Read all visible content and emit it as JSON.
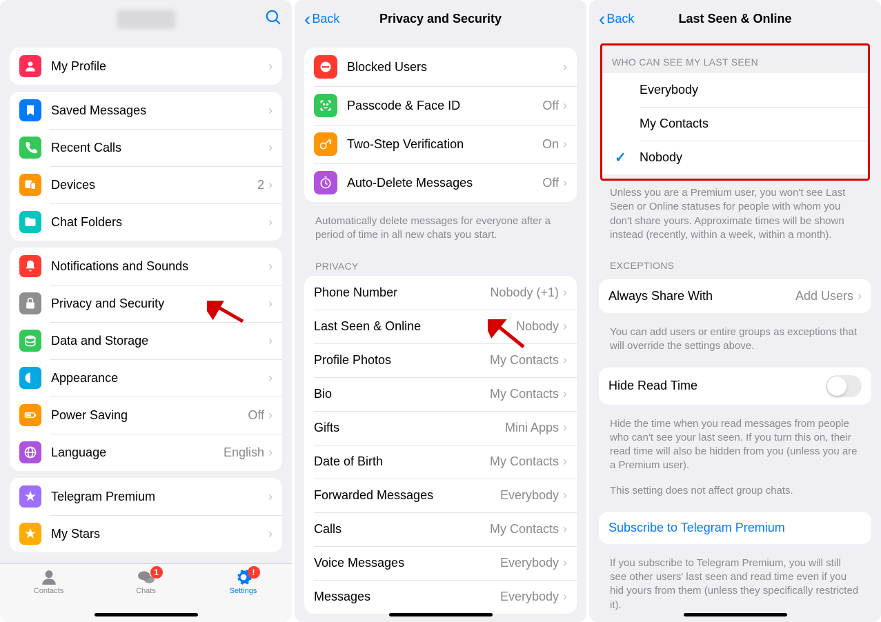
{
  "p1": {
    "groups": [
      [
        {
          "label": "My Profile",
          "ic": "profile",
          "bg": "#ff2d55"
        }
      ],
      [
        {
          "label": "Saved Messages",
          "ic": "bookmark",
          "bg": "#007aff"
        },
        {
          "label": "Recent Calls",
          "ic": "phone",
          "bg": "#34c759"
        },
        {
          "label": "Devices",
          "ic": "devices",
          "bg": "#ff9500",
          "val": "2"
        },
        {
          "label": "Chat Folders",
          "ic": "folder",
          "bg": "#00c7be"
        }
      ],
      [
        {
          "label": "Notifications and Sounds",
          "ic": "bell",
          "bg": "#ff3b30"
        },
        {
          "label": "Privacy and Security",
          "ic": "lock",
          "bg": "#8e8e93"
        },
        {
          "label": "Data and Storage",
          "ic": "storage",
          "bg": "#34c759"
        },
        {
          "label": "Appearance",
          "ic": "appearance",
          "bg": "#06a7e2"
        },
        {
          "label": "Power Saving",
          "ic": "battery",
          "bg": "#ff9500",
          "val": "Off"
        },
        {
          "label": "Language",
          "ic": "globe",
          "bg": "#af52de",
          "val": "English"
        }
      ],
      [
        {
          "label": "Telegram Premium",
          "ic": "star",
          "bg": "#9d6fff"
        },
        {
          "label": "My Stars",
          "ic": "star",
          "bg": "#ffab00"
        }
      ]
    ],
    "tabs": [
      {
        "l": "Contacts",
        "ic": "contact"
      },
      {
        "l": "Chats",
        "ic": "chats",
        "b": "1"
      },
      {
        "l": "Settings",
        "ic": "gear",
        "b": "!",
        "active": true
      }
    ]
  },
  "p2": {
    "back": "Back",
    "title": "Privacy and Security",
    "security": [
      {
        "label": "Blocked Users",
        "ic": "block",
        "bg": "#ff3b30",
        "val": ""
      },
      {
        "label": "Passcode & Face ID",
        "ic": "faceid",
        "bg": "#34c759",
        "val": "Off"
      },
      {
        "label": "Two-Step Verification",
        "ic": "key",
        "bg": "#ff9500",
        "val": "On"
      },
      {
        "label": "Auto-Delete Messages",
        "ic": "timer",
        "bg": "#af52de",
        "val": "Off"
      }
    ],
    "sec_ft": "Automatically delete messages for everyone after a period of time in all new chats you start.",
    "priv_hdr": "PRIVACY",
    "privacy": [
      {
        "label": "Phone Number",
        "val": "Nobody (+1)"
      },
      {
        "label": "Last Seen & Online",
        "val": "Nobody"
      },
      {
        "label": "Profile Photos",
        "val": "My Contacts"
      },
      {
        "label": "Bio",
        "val": "My Contacts"
      },
      {
        "label": "Gifts",
        "val": "Mini Apps"
      },
      {
        "label": "Date of Birth",
        "val": "My Contacts"
      },
      {
        "label": "Forwarded Messages",
        "val": "Everybody"
      },
      {
        "label": "Calls",
        "val": "My Contacts"
      },
      {
        "label": "Voice Messages",
        "val": "Everybody"
      },
      {
        "label": "Messages",
        "val": "Everybody"
      }
    ]
  },
  "p3": {
    "back": "Back",
    "title": "Last Seen & Online",
    "who_hdr": "WHO CAN SEE MY LAST SEEN",
    "options": [
      "Everybody",
      "My Contacts",
      "Nobody"
    ],
    "selected": 2,
    "who_ft": "Unless you are a Premium user, you won't see Last Seen or Online statuses for people with whom you don't share yours. Approximate times will be shown instead (recently, within a week, within a month).",
    "exc_hdr": "EXCEPTIONS",
    "always": "Always Share With",
    "add": "Add Users",
    "exc_ft": "You can add users or entire groups as exceptions that will override the settings above.",
    "hide": "Hide Read Time",
    "hide_ft": "Hide the time when you read messages from people who can't see your last seen. If you turn this on, their read time will also be hidden from you (unless you are a Premium user).",
    "hide_ft2": "This setting does not affect group chats.",
    "premium": "Subscribe to Telegram Premium",
    "premium_ft": "If you subscribe to Telegram Premium, you will still see other users' last seen and read time even if you hid yours from them (unless they specifically restricted it)."
  }
}
